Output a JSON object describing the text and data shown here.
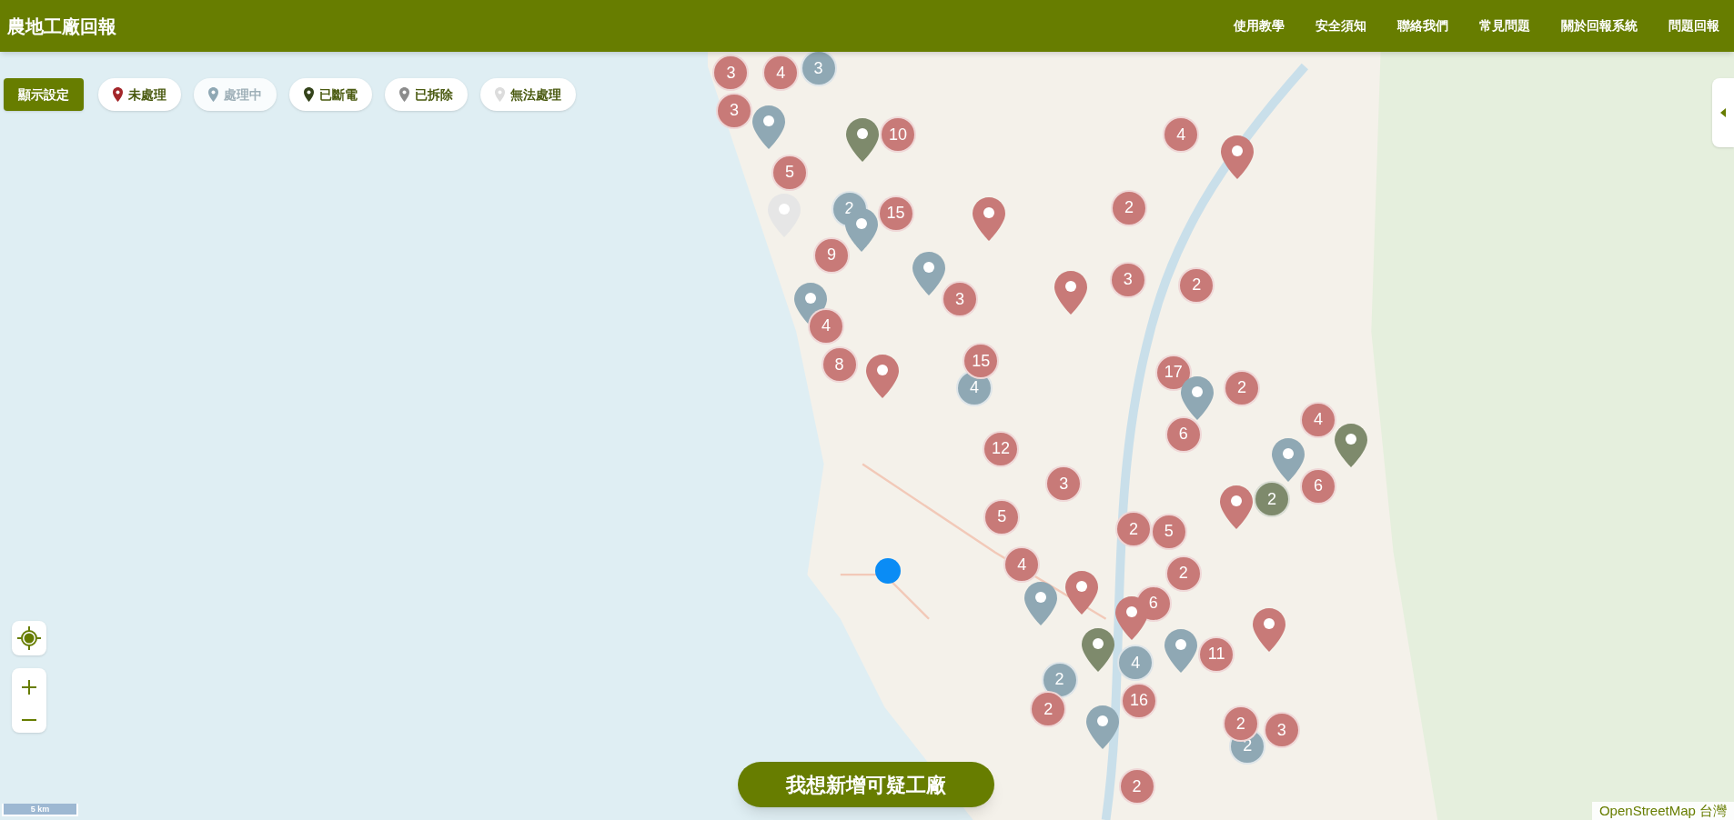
{
  "header": {
    "title": "農地工廠回報",
    "nav": [
      "使用教學",
      "安全須知",
      "聯絡我們",
      "常見問題",
      "關於回報系統",
      "問題回報"
    ]
  },
  "display_settings_button": "顯示設定",
  "filters": [
    {
      "label": "未處理",
      "color": "#a3262a",
      "on": true
    },
    {
      "label": "處理中",
      "color": "#8fa8b4",
      "on": false
    },
    {
      "label": "已斷電",
      "color": "#34431a",
      "on": true
    },
    {
      "label": "已拆除",
      "color": "#8c8c8c",
      "on": true
    },
    {
      "label": "無法處理",
      "color": "#dcdcdc",
      "on": true
    }
  ],
  "markers": [
    {
      "kind": "cluster",
      "color": "#c87a78",
      "count": "3"
    },
    {
      "kind": "cluster",
      "color": "#c87a78",
      "count": "4"
    },
    {
      "kind": "cluster",
      "color": "#8fa8b4",
      "count": "3"
    },
    {
      "kind": "cluster",
      "color": "#c87a78",
      "count": "3"
    },
    {
      "kind": "pin",
      "color": "#8fa8b4"
    },
    {
      "kind": "pin",
      "color": "#7e8a6c"
    },
    {
      "kind": "cluster",
      "color": "#c87a78",
      "count": "10"
    },
    {
      "kind": "cluster",
      "color": "#c87a78",
      "count": "5"
    },
    {
      "kind": "pin",
      "color": "#e6e6e6"
    },
    {
      "kind": "cluster",
      "color": "#8fa8b4",
      "count": "2"
    },
    {
      "kind": "pin",
      "color": "#8fa8b4"
    },
    {
      "kind": "cluster",
      "color": "#c87a78",
      "count": "15"
    },
    {
      "kind": "pin",
      "color": "#c87a78"
    },
    {
      "kind": "cluster",
      "color": "#c87a78",
      "count": "9"
    },
    {
      "kind": "pin",
      "color": "#8fa8b4"
    },
    {
      "kind": "cluster",
      "color": "#c87a78",
      "count": "3"
    },
    {
      "kind": "pin",
      "color": "#8fa8b4"
    },
    {
      "kind": "cluster",
      "color": "#c87a78",
      "count": "4"
    },
    {
      "kind": "cluster",
      "color": "#c87a78",
      "count": "8"
    },
    {
      "kind": "pin",
      "color": "#c87a78"
    },
    {
      "kind": "cluster",
      "color": "#8fa8b4",
      "count": "4"
    },
    {
      "kind": "cluster",
      "color": "#c87a78",
      "count": "15"
    },
    {
      "kind": "cluster",
      "color": "#c87a78",
      "count": "4"
    },
    {
      "kind": "pin",
      "color": "#c87a78"
    },
    {
      "kind": "cluster",
      "color": "#c87a78",
      "count": "2"
    },
    {
      "kind": "pin",
      "color": "#c87a78"
    },
    {
      "kind": "cluster",
      "color": "#c87a78",
      "count": "3"
    },
    {
      "kind": "cluster",
      "color": "#c87a78",
      "count": "2"
    },
    {
      "kind": "cluster",
      "color": "#c87a78",
      "count": "17"
    },
    {
      "kind": "pin",
      "color": "#8fa8b4"
    },
    {
      "kind": "cluster",
      "color": "#c87a78",
      "count": "2"
    },
    {
      "kind": "cluster",
      "color": "#c87a78",
      "count": "6"
    },
    {
      "kind": "cluster",
      "color": "#c87a78",
      "count": "4"
    },
    {
      "kind": "pin",
      "color": "#8fa8b4"
    },
    {
      "kind": "pin",
      "color": "#7e8a6c"
    },
    {
      "kind": "cluster",
      "color": "#c87a78",
      "count": "6"
    },
    {
      "kind": "cluster",
      "color": "#c87a78",
      "count": "12"
    },
    {
      "kind": "cluster",
      "color": "#c87a78",
      "count": "3"
    },
    {
      "kind": "cluster",
      "color": "#7e8a6c",
      "count": "2"
    },
    {
      "kind": "pin",
      "color": "#c87a78"
    },
    {
      "kind": "cluster",
      "color": "#c87a78",
      "count": "5"
    },
    {
      "kind": "cluster",
      "color": "#c87a78",
      "count": "2"
    },
    {
      "kind": "cluster",
      "color": "#c87a78",
      "count": "5"
    },
    {
      "kind": "cluster",
      "color": "#c87a78",
      "count": "4"
    },
    {
      "kind": "pin",
      "color": "#c87a78"
    },
    {
      "kind": "pin",
      "color": "#8fa8b4"
    },
    {
      "kind": "cluster",
      "color": "#c87a78",
      "count": "2"
    },
    {
      "kind": "cluster",
      "color": "#c87a78",
      "count": "6"
    },
    {
      "kind": "pin",
      "color": "#7e8a6c"
    },
    {
      "kind": "pin",
      "color": "#c87a78"
    },
    {
      "kind": "pin",
      "color": "#c87a78"
    },
    {
      "kind": "pin",
      "color": "#8fa8b4"
    },
    {
      "kind": "cluster",
      "color": "#c87a78",
      "count": "11"
    },
    {
      "kind": "cluster",
      "color": "#8fa8b4",
      "count": "4"
    },
    {
      "kind": "cluster",
      "color": "#8fa8b4",
      "count": "2"
    },
    {
      "kind": "cluster",
      "color": "#c87a78",
      "count": "2"
    },
    {
      "kind": "cluster",
      "color": "#c87a78",
      "count": "16"
    },
    {
      "kind": "pin",
      "color": "#8fa8b4"
    },
    {
      "kind": "cluster",
      "color": "#8fa8b4",
      "count": "2"
    },
    {
      "kind": "cluster",
      "color": "#c87a78",
      "count": "2"
    },
    {
      "kind": "cluster",
      "color": "#c87a78",
      "count": "3"
    },
    {
      "kind": "cluster",
      "color": "#c87a78",
      "count": "2"
    }
  ],
  "add_factory_button": "我想新增可疑工廠",
  "scale_bar": "5 km",
  "attribution": "OpenStreetMap 台灣"
}
